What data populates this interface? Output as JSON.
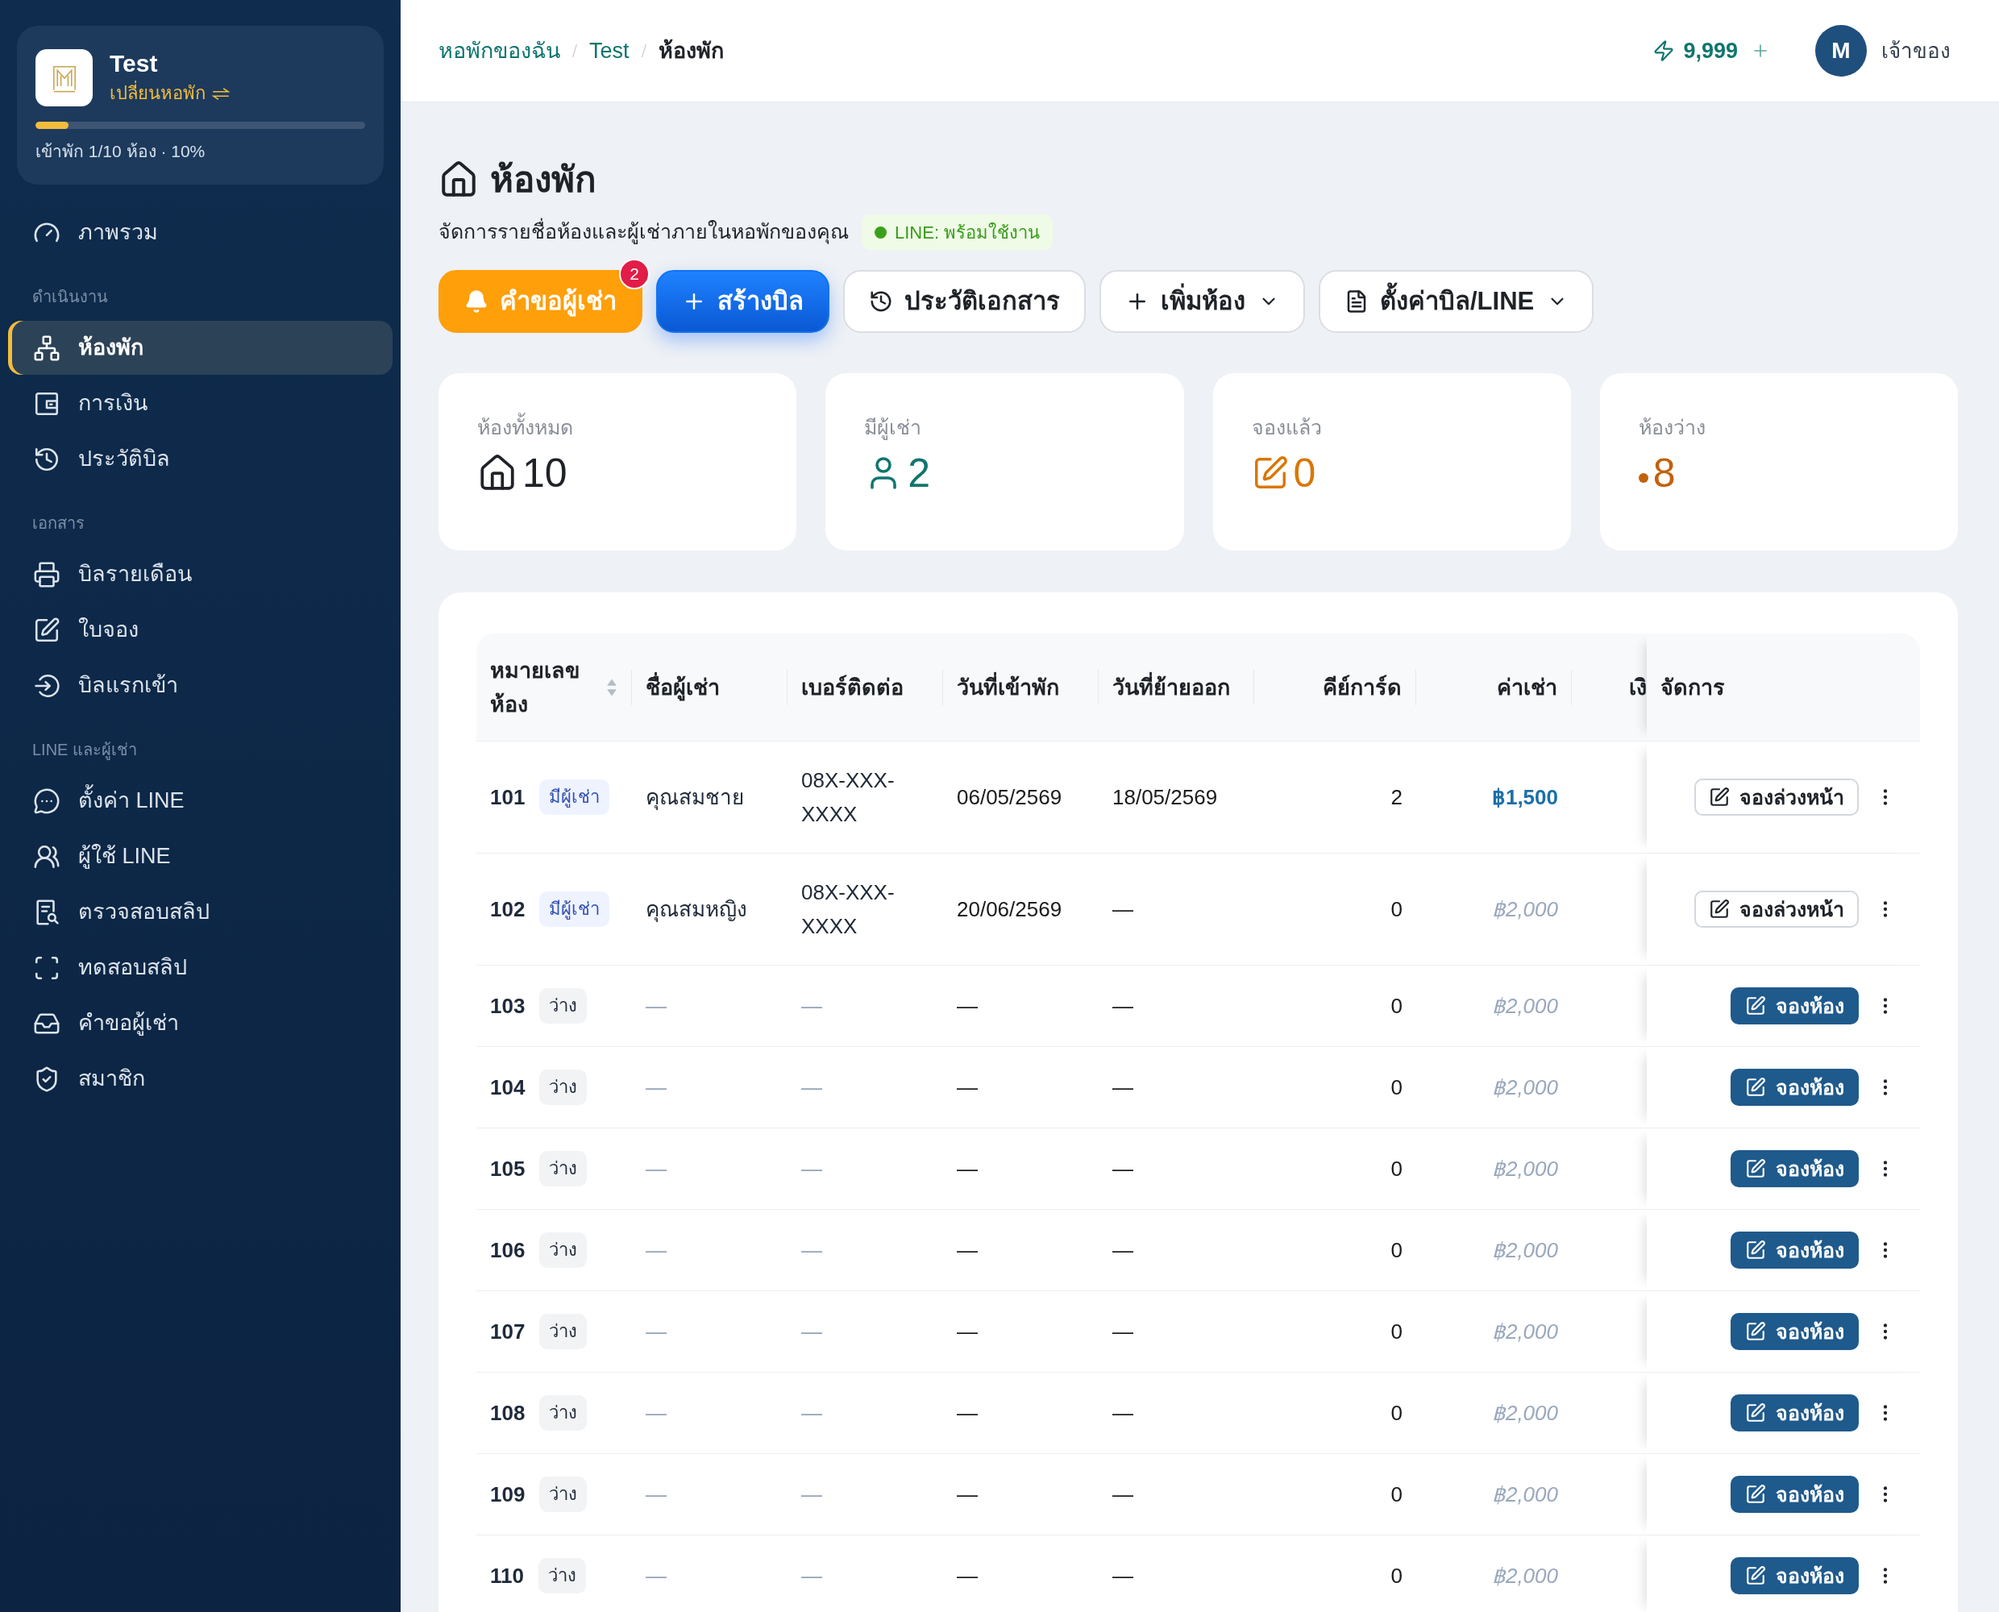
{
  "sidebar": {
    "brand": {
      "name": "Test",
      "switch_label": "เปลี่ยนหอพัก",
      "occupancy": {
        "level": 0.1,
        "text": "เข้าพัก 1/10 ห้อง · 10%"
      }
    },
    "sections": [
      {
        "items": [
          {
            "label": "ภาพรวม",
            "selected": false
          }
        ]
      },
      {
        "heading": "ดำเนินงาน",
        "items": [
          {
            "label": "ห้องพัก",
            "selected": true
          },
          {
            "label": "การเงิน",
            "selected": false
          },
          {
            "label": "ประวัติบิล",
            "selected": false
          }
        ]
      },
      {
        "heading": "เอกสาร",
        "items": [
          {
            "label": "บิลรายเดือน",
            "selected": false
          },
          {
            "label": "ใบจอง",
            "selected": false
          },
          {
            "label": "บิลแรกเข้า",
            "selected": false
          }
        ]
      },
      {
        "heading": "LINE และผู้เช่า",
        "items": [
          {
            "label": "ตั้งค่า LINE",
            "selected": false
          },
          {
            "label": "ผู้ใช้ LINE",
            "selected": false
          },
          {
            "label": "ตรวจสอบสลิป",
            "selected": false
          },
          {
            "label": "ทดสอบสลิป",
            "selected": false
          },
          {
            "label": "คำขอผู้เช่า",
            "selected": false
          },
          {
            "label": "สมาชิก",
            "selected": false
          }
        ]
      }
    ]
  },
  "header": {
    "breadcrumb": [
      {
        "label": "หอพักของฉัน",
        "current": false
      },
      {
        "label": "Test",
        "current": false
      },
      {
        "label": "ห้องพัก",
        "current": true
      }
    ],
    "credits": "9,999",
    "user": {
      "initial": "M",
      "role": "เจ้าของ"
    }
  },
  "page": {
    "title": "ห้องพัก",
    "subtitle": "จัดการรายชื่อห้องและผู้เช่าภายในหอพักของคุณ",
    "line_status": {
      "label": "LINE: พร้อมใช้งาน",
      "connected": true
    }
  },
  "actions": [
    {
      "label": "คำขอผู้เช่า",
      "kind": "warning",
      "badge": "2",
      "dropdown": false
    },
    {
      "label": "สร้างบิล",
      "kind": "primary",
      "dropdown": false
    },
    {
      "label": "ประวัติเอกสาร",
      "kind": "outline",
      "dropdown": false
    },
    {
      "label": "เพิ่มห้อง",
      "kind": "outline",
      "dropdown": true
    },
    {
      "label": "ตั้งค่าบิล/LINE",
      "kind": "outline",
      "dropdown": true
    }
  ],
  "stats": [
    {
      "label": "ห้องทั้งหมด",
      "value": "10",
      "color": "#1f2328"
    },
    {
      "label": "มีผู้เช่า",
      "value": "2",
      "color": "#0f766e"
    },
    {
      "label": "จองแล้ว",
      "value": "0",
      "color": "#d97706"
    },
    {
      "label": "ห้องว่าง",
      "value": "8",
      "color": "#c2610c"
    }
  ],
  "table": {
    "columns": [
      {
        "label": "หมายเลขห้อง",
        "sortable": true
      },
      {
        "label": "ชื่อผู้เช่า",
        "sortable": false
      },
      {
        "label": "เบอร์ติดต่อ",
        "sortable": false
      },
      {
        "label": "วันที่เข้าพัก",
        "sortable": false
      },
      {
        "label": "วันที่ย้ายออก",
        "sortable": false
      },
      {
        "label": "คีย์การ์ด",
        "sortable": false
      },
      {
        "label": "ค่าเช่า",
        "sortable": false
      },
      {
        "label": "เงิ",
        "sortable": false
      },
      {
        "label": "จัดการ",
        "sortable": false
      }
    ],
    "rows": [
      {
        "room": "101",
        "status": {
          "label": "มีผู้เช่า",
          "kind": "occupied"
        },
        "tenant": "คุณสมชาย",
        "phone": "08X-XXX-XXXX",
        "check_in": "06/05/2569",
        "check_out": "18/05/2569",
        "keycards": "2",
        "rent": {
          "text": "฿1,500",
          "kind": "custom"
        },
        "action": {
          "label": "จองล่วงหน้า",
          "kind": "outline"
        }
      },
      {
        "room": "102",
        "status": {
          "label": "มีผู้เช่า",
          "kind": "occupied"
        },
        "tenant": "คุณสมหญิง",
        "phone": "08X-XXX-XXXX",
        "check_in": "20/06/2569",
        "check_out": "—",
        "keycards": "0",
        "rent": {
          "text": "฿2,000",
          "kind": "default"
        },
        "action": {
          "label": "จองล่วงหน้า",
          "kind": "outline"
        }
      },
      {
        "room": "103",
        "status": {
          "label": "ว่าง",
          "kind": "vacant"
        },
        "tenant": "—",
        "phone": "—",
        "check_in": "—",
        "check_out": "—",
        "keycards": "0",
        "rent": {
          "text": "฿2,000",
          "kind": "default"
        },
        "action": {
          "label": "จองห้อง",
          "kind": "filled"
        }
      },
      {
        "room": "104",
        "status": {
          "label": "ว่าง",
          "kind": "vacant"
        },
        "tenant": "—",
        "phone": "—",
        "check_in": "—",
        "check_out": "—",
        "keycards": "0",
        "rent": {
          "text": "฿2,000",
          "kind": "default"
        },
        "action": {
          "label": "จองห้อง",
          "kind": "filled"
        }
      },
      {
        "room": "105",
        "status": {
          "label": "ว่าง",
          "kind": "vacant"
        },
        "tenant": "—",
        "phone": "—",
        "check_in": "—",
        "check_out": "—",
        "keycards": "0",
        "rent": {
          "text": "฿2,000",
          "kind": "default"
        },
        "action": {
          "label": "จองห้อง",
          "kind": "filled"
        }
      },
      {
        "room": "106",
        "status": {
          "label": "ว่าง",
          "kind": "vacant"
        },
        "tenant": "—",
        "phone": "—",
        "check_in": "—",
        "check_out": "—",
        "keycards": "0",
        "rent": {
          "text": "฿2,000",
          "kind": "default"
        },
        "action": {
          "label": "จองห้อง",
          "kind": "filled"
        }
      },
      {
        "room": "107",
        "status": {
          "label": "ว่าง",
          "kind": "vacant"
        },
        "tenant": "—",
        "phone": "—",
        "check_in": "—",
        "check_out": "—",
        "keycards": "0",
        "rent": {
          "text": "฿2,000",
          "kind": "default"
        },
        "action": {
          "label": "จองห้อง",
          "kind": "filled"
        }
      },
      {
        "room": "108",
        "status": {
          "label": "ว่าง",
          "kind": "vacant"
        },
        "tenant": "—",
        "phone": "—",
        "check_in": "—",
        "check_out": "—",
        "keycards": "0",
        "rent": {
          "text": "฿2,000",
          "kind": "default"
        },
        "action": {
          "label": "จองห้อง",
          "kind": "filled"
        }
      },
      {
        "room": "109",
        "status": {
          "label": "ว่าง",
          "kind": "vacant"
        },
        "tenant": "—",
        "phone": "—",
        "check_in": "—",
        "check_out": "—",
        "keycards": "0",
        "rent": {
          "text": "฿2,000",
          "kind": "default"
        },
        "action": {
          "label": "จองห้อง",
          "kind": "filled"
        }
      },
      {
        "room": "110",
        "status": {
          "label": "ว่าง",
          "kind": "vacant"
        },
        "tenant": "—",
        "phone": "—",
        "check_in": "—",
        "check_out": "—",
        "keycards": "0",
        "rent": {
          "text": "฿2,000",
          "kind": "default"
        },
        "action": {
          "label": "จองห้อง",
          "kind": "filled"
        }
      }
    ]
  }
}
